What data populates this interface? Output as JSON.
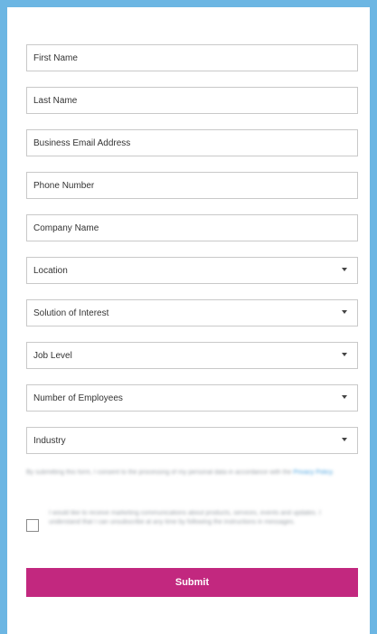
{
  "form": {
    "text_fields": [
      {
        "placeholder": "First Name"
      },
      {
        "placeholder": "Last Name"
      },
      {
        "placeholder": "Business Email Address"
      },
      {
        "placeholder": "Phone Number"
      },
      {
        "placeholder": "Company Name"
      }
    ],
    "selects": [
      {
        "label": "Location"
      },
      {
        "label": "Solution of Interest"
      },
      {
        "label": "Job Level"
      },
      {
        "label": "Number of Employees"
      },
      {
        "label": "Industry"
      }
    ],
    "consent_text": "By submitting this form, I consent to the processing of my personal data in accordance with the",
    "consent_link": "Privacy Policy",
    "checkbox_text": "I would like to receive marketing communications about products, services, events and updates. I understand that I can unsubscribe at any time by following the instructions in messages.",
    "submit_label": "Submit"
  },
  "colors": {
    "frame": "#6cb6e3",
    "submit": "#c2287f",
    "field_border": "#c9c9c9"
  }
}
